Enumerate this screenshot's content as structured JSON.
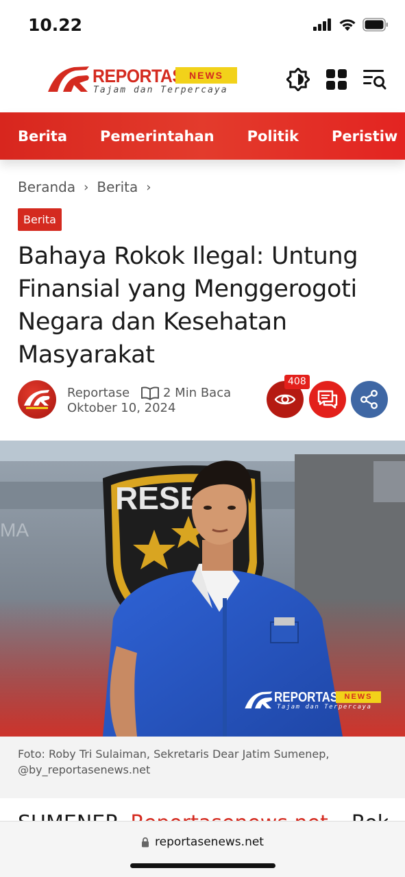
{
  "status_bar": {
    "time": "10.22"
  },
  "header": {
    "logo_text": "REPORTASE",
    "logo_news": "NEWS",
    "logo_tagline": "Tajam dan Terpercaya",
    "icons": [
      "theme-toggle-icon",
      "grid-menu-icon",
      "search-menu-icon"
    ]
  },
  "nav": {
    "items": [
      "Berita",
      "Pemerintahan",
      "Politik",
      "Peristiw"
    ]
  },
  "breadcrumb": {
    "items": [
      "Beranda",
      "Berita"
    ]
  },
  "article": {
    "category": "Berita",
    "title": "Bahaya Rokok Ilegal: Untung Finansial yang Menggerogoti Negara dan Kesehatan Masyarakat",
    "author": "Reportase",
    "read_time": "2 Min Baca",
    "date": "Oktober 10, 2024",
    "views": "408",
    "caption": "Foto: Roby Tri Sulaiman, Sekretaris Dear Jatim Sumenep, @by_reportasenews.net",
    "body_start": "SUMENEP,",
    "body_link": "Reportasenews.net",
    "body_rest": "– Rokok"
  },
  "watermark": {
    "text": "REPORTASE",
    "news": "NEWS",
    "tagline": "Tajam dan Terpercaya"
  },
  "browser": {
    "url": "reportasenews.net"
  },
  "colors": {
    "brand_red": "#d42a1f",
    "news_yellow": "#f2d21a",
    "share_blue": "#3f67a4"
  }
}
